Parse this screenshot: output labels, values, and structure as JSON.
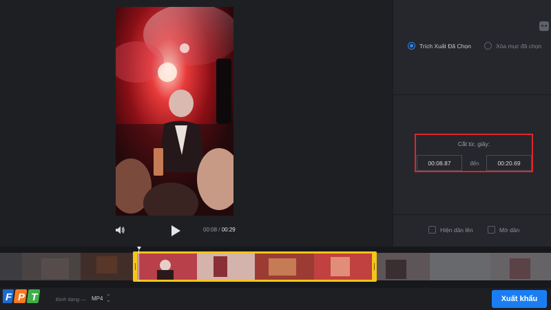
{
  "player": {
    "current_time": "00:08",
    "separator": "/",
    "total_time": "00:29"
  },
  "panel": {
    "radio_extract_label": "Trích Xuất Đã Chọn",
    "radio_delete_label": "Xóa mục đã chọn",
    "selected_mode": "extract",
    "cut_title": "Cắt từ, giây:",
    "cut_start": "00:08.87",
    "cut_to_label": "đến",
    "cut_end": "00:20.69",
    "fade_in_label": "Hiện dần lên",
    "fade_out_label": "Mờ dần"
  },
  "bottom": {
    "format_label": "Định dạng —",
    "format_value": "MP4",
    "format_caret": "⌃⌄",
    "export_label": "Xuất khẩu"
  },
  "brand": {
    "logo_text": "FPT"
  },
  "colors": {
    "accent": "#1a7ef2",
    "selection": "#f5c518",
    "highlight_box": "#e0262b"
  },
  "icons": {
    "volume": "speaker-icon",
    "play": "play-icon",
    "corner": "gamepad-icon"
  }
}
